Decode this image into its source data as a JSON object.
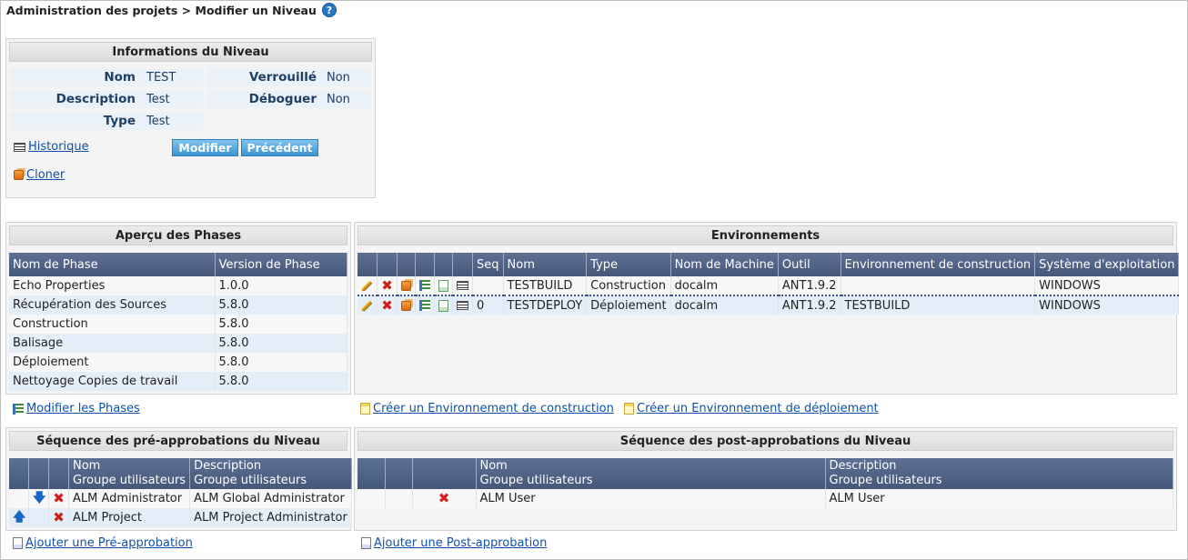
{
  "breadcrumb": "Administration des projets > Modifier un Niveau",
  "help_icon": "?",
  "info": {
    "title": "Informations du Niveau",
    "nom_label": "Nom",
    "nom_value": "TEST",
    "verrouille_label": "Verrouillé",
    "verrouille_value": "Non",
    "description_label": "Description",
    "description_value": "Test",
    "deboguer_label": "Déboguer",
    "deboguer_value": "Non",
    "type_label": "Type",
    "type_value": "Test",
    "historique_link": "Historique",
    "modifier_button": "Modifier",
    "precedent_button": "Précédent",
    "cloner_link": "Cloner"
  },
  "phases": {
    "title": "Aperçu des Phases",
    "headers": [
      "Nom de Phase",
      "Version de Phase"
    ],
    "rows": [
      [
        "Echo Properties",
        "1.0.0"
      ],
      [
        "Récupération des Sources",
        "5.8.0"
      ],
      [
        "Construction",
        "5.8.0"
      ],
      [
        "Balisage",
        "5.8.0"
      ],
      [
        "Déploiement",
        "5.8.0"
      ],
      [
        "Nettoyage Copies de travail",
        "5.8.0"
      ]
    ],
    "modify_link": "Modifier les Phases"
  },
  "environments": {
    "title": "Environnements",
    "headers": [
      "Seq",
      "Nom",
      "Type",
      "Nom de Machine",
      "Outil",
      "Environnement de construction",
      "Système d'exploitation"
    ],
    "rows": [
      [
        "",
        "TESTBUILD",
        "Construction",
        "docalm",
        "ANT1.9.2",
        "",
        "WINDOWS"
      ],
      [
        "0",
        "TESTDEPLOY",
        "Déploiement",
        "docalm",
        "ANT1.9.2",
        "TESTBUILD",
        "WINDOWS"
      ]
    ],
    "create_build_link": "Créer un Environnement de construction",
    "create_deploy_link": "Créer un Environnement de déploiement"
  },
  "pre_approvals": {
    "title": "Séquence des pré-approbations du Niveau",
    "header_nom_1": "Nom",
    "header_nom_2": "Groupe utilisateurs",
    "header_desc_1": "Description",
    "header_desc_2": "Groupe utilisateurs",
    "rows": [
      [
        "ALM Administrator",
        "ALM Global Administrator"
      ],
      [
        "ALM Project",
        "ALM Project Administrator"
      ]
    ],
    "add_link": "Ajouter une Pré-approbation"
  },
  "post_approvals": {
    "title": "Séquence des post-approbations du Niveau",
    "header_nom_1": "Nom",
    "header_nom_2": "Groupe utilisateurs",
    "header_desc_1": "Description",
    "header_desc_2": "Groupe utilisateurs",
    "rows": [
      [
        "ALM User",
        "ALM User"
      ]
    ],
    "add_link": "Ajouter une Post-approbation"
  },
  "icons": {
    "edit": "pencil-icon",
    "delete": "red-x-icon",
    "clone": "clone-icon",
    "phases": "phases-icon",
    "doc": "document-icon",
    "history": "history-icon",
    "new": "new-document-icon",
    "up": "arrow-up-icon",
    "down": "arrow-down-icon",
    "add": "add-document-icon"
  },
  "colors": {
    "header_bg": "#4e6285",
    "accent_blue": "#1050a8",
    "button_blue": "#3e95d3",
    "label_blue": "#1e3f66",
    "delete_red": "#d0201e"
  }
}
